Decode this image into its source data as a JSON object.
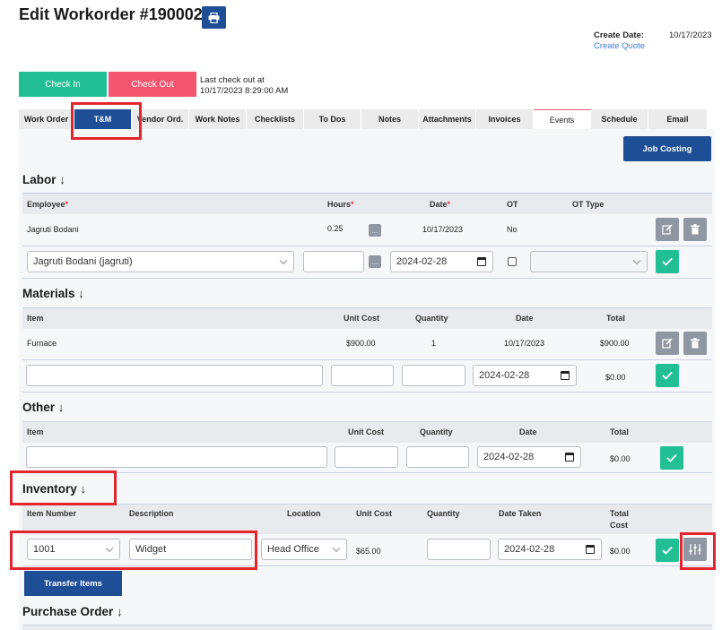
{
  "header": {
    "title": "Edit Workorder #190002",
    "create_date_label": "Create Date:",
    "create_date_value": "10/17/2023",
    "create_quote_link": "Create Quote"
  },
  "checkin": {
    "in_label": "Check In",
    "out_label": "Check Out",
    "last_checkout_line1": "Last check out at",
    "last_checkout_line2": "10/17/2023 8:29:00 AM"
  },
  "tabs": [
    "Work Order",
    "T&M",
    "Vendor Ord.",
    "Work Notes",
    "Checklists",
    "To Dos",
    "Notes",
    "Attachments",
    "Invoices",
    "Events",
    "Schedule",
    "Email"
  ],
  "job_costing_label": "Job Costing",
  "labor": {
    "title": "Labor",
    "headers": {
      "employee": "Employee",
      "hours": "Hours",
      "date": "Date",
      "ot": "OT",
      "ot_type": "OT Type"
    },
    "row": {
      "employee": "Jagruti Bodani",
      "hours": "0.25",
      "date": "10/17/2023",
      "ot": "No"
    },
    "new": {
      "employee": "Jagruti Bodani (jagruti)",
      "date": "2024-02-28"
    }
  },
  "materials": {
    "title": "Materials",
    "headers": {
      "item": "Item",
      "unit_cost": "Unit Cost",
      "quantity": "Quantity",
      "date": "Date",
      "total": "Total"
    },
    "row": {
      "item": "Furnace",
      "unit_cost": "$900.00",
      "quantity": "1",
      "date": "10/17/2023",
      "total": "$900.00"
    },
    "new": {
      "date": "2024-02-28",
      "total": "$0.00"
    }
  },
  "other": {
    "title": "Other",
    "headers": {
      "item": "Item",
      "unit_cost": "Unit Cost",
      "quantity": "Quantity",
      "date": "Date",
      "total": "Total"
    },
    "new": {
      "date": "2024-02-28",
      "total": "$0.00"
    }
  },
  "inventory": {
    "title": "Inventory",
    "headers": {
      "item_number": "Item Number",
      "description": "Description",
      "location": "Location",
      "unit_cost": "Unit Cost",
      "quantity": "Quantity",
      "date_taken": "Date Taken",
      "total_cost_1": "Total",
      "total_cost_2": "Cost"
    },
    "new": {
      "item_number": "1001",
      "description": "Widget",
      "location": "Head Office",
      "unit_cost": "$65.00",
      "date_taken": "2024-02-28",
      "total": "$0.00"
    },
    "transfer_label": "Transfer Items"
  },
  "purchase_order": {
    "title": "Purchase Order"
  },
  "colors": {
    "primary": "#1e4e96",
    "green": "#22bf94",
    "red": "#f2576f",
    "highlight": "#e3262e"
  }
}
